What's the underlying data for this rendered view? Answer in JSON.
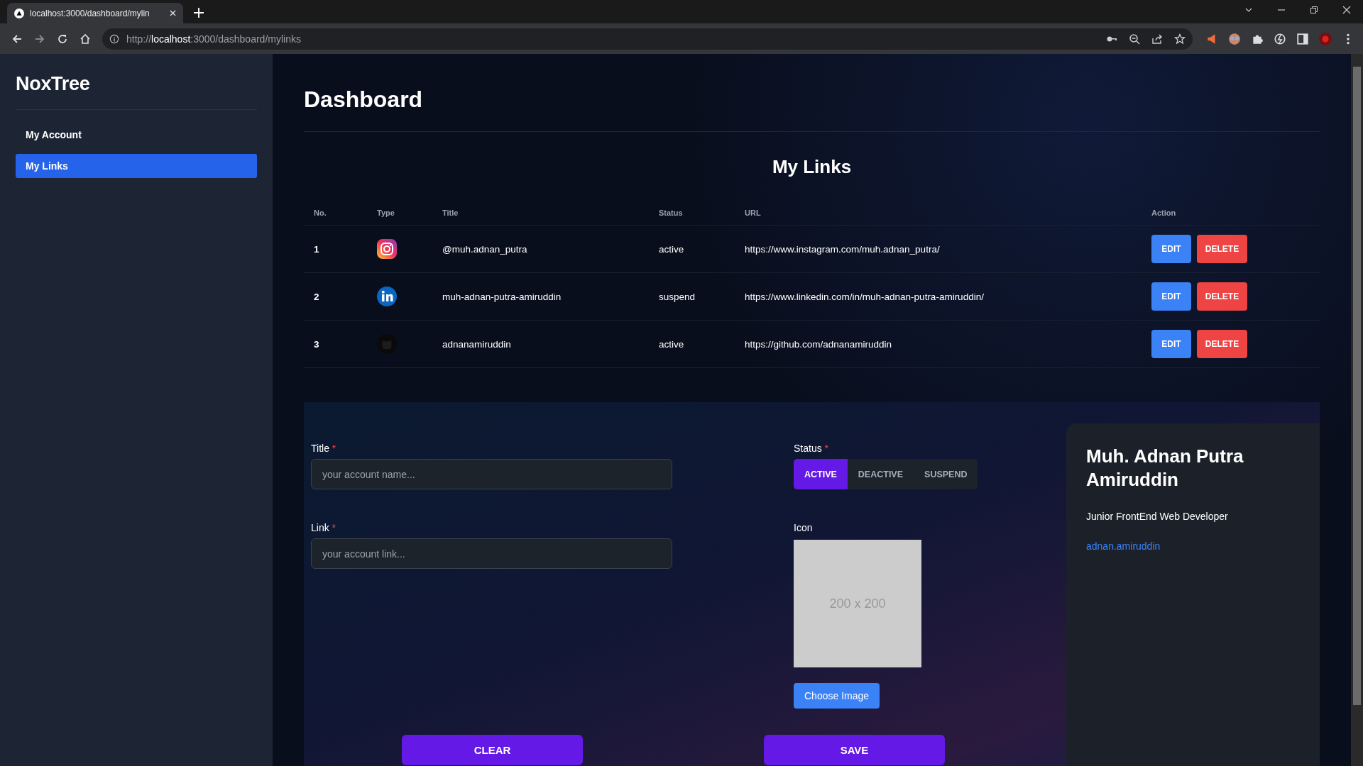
{
  "browser": {
    "tab_title": "localhost:3000/dashboard/mylin",
    "address": {
      "scheme": "http://",
      "host": "localhost",
      "path": ":3000/dashboard/mylinks"
    }
  },
  "sidebar": {
    "brand": "NoxTree",
    "items": [
      {
        "label": "My Account",
        "selected": false
      },
      {
        "label": "My Links",
        "selected": true
      }
    ]
  },
  "page_title": "Dashboard",
  "links_table": {
    "title": "My Links",
    "columns": [
      "No.",
      "Type",
      "Title",
      "Status",
      "URL",
      "Action"
    ],
    "rows": [
      {
        "no": "1",
        "kind": "instagram",
        "title": "@muh.adnan_putra",
        "status": "active",
        "url": "https://www.instagram.com/muh.adnan_putra/",
        "actions": [
          "EDIT",
          "DELETE"
        ]
      },
      {
        "no": "2",
        "kind": "linkedin",
        "title": "muh-adnan-putra-amiruddin",
        "status": "suspend",
        "url": "https://www.linkedin.com/in/muh-adnan-putra-amiruddin/",
        "actions": [
          "EDIT",
          "DELETE"
        ]
      },
      {
        "no": "3",
        "kind": "github",
        "title": "adnanamiruddin",
        "status": "active",
        "url": "https://github.com/adnanamiruddin",
        "actions": [
          "EDIT",
          "DELETE"
        ]
      }
    ]
  },
  "form": {
    "title_field": {
      "label": "Title",
      "required_mark": "*",
      "placeholder": "your account name..."
    },
    "link_field": {
      "label": "Link",
      "required_mark": "*",
      "placeholder": "your account link..."
    },
    "status": {
      "label": "Status",
      "required_mark": "*",
      "options": [
        {
          "label": "ACTIVE",
          "selected": true
        },
        {
          "label": "DEACTIVE",
          "selected": false
        },
        {
          "label": "SUSPEND",
          "selected": false
        }
      ]
    },
    "icon": {
      "label": "Icon",
      "placeholder_text": "200 x 200",
      "button": "Choose Image"
    },
    "clear_button": "CLEAR",
    "save_button": "SAVE"
  },
  "profile_card": {
    "name": "Muh. Adnan Putra Amiruddin",
    "role": "Junior FrontEnd Web Developer",
    "link": "adnan.amiruddin"
  }
}
